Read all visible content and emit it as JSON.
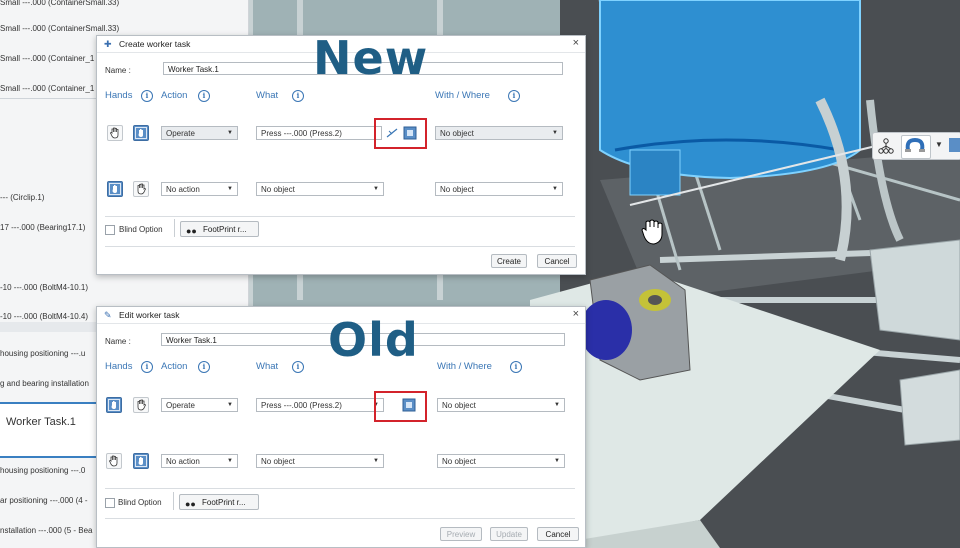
{
  "tree": {
    "items": [
      "Small ---.000 (ContainerSmall.33)",
      "Small ---.000 (Container_1",
      "Small ---.000 (Container_1",
      "--- (Circlip.1)",
      "17 ---.000 (Bearing17.1)",
      "-10 ---.000 (BoltM4-10.1)",
      "-10 ---.000 (BoltM4-10.4)",
      "housing positioning ---.u",
      "g and bearing installation",
      "housing positioning ---.0",
      "ar positioning ---.000 (4 -",
      "nstallation ---.000 (5 - Bea"
    ],
    "selected": "Worker Task.1"
  },
  "new_dialog": {
    "title": "Create worker task",
    "name_label": "Name :",
    "name_value": "Worker Task.1",
    "headers": {
      "hands": "Hands",
      "action": "Action",
      "what": "What",
      "with": "With / Where"
    },
    "row1": {
      "action": "Operate",
      "what": "Press ---.000 (Press.2)",
      "with": "No object"
    },
    "row2": {
      "action": "No action",
      "what": "No object",
      "with": "No object"
    },
    "blind_option": "Blind Option",
    "footprint": "FootPrint r...",
    "buttons": {
      "create": "Create",
      "cancel": "Cancel"
    }
  },
  "old_dialog": {
    "title": "Edit worker task",
    "name_label": "Name :",
    "name_value": "Worker Task.1",
    "headers": {
      "hands": "Hands",
      "action": "Action",
      "what": "What",
      "with": "With / Where"
    },
    "row1": {
      "action": "Operate",
      "what": "Press ---.000 (Press.2)",
      "with": "No object"
    },
    "row2": {
      "action": "No action",
      "what": "No object",
      "with": "No object"
    },
    "blind_option": "Blind Option",
    "footprint": "FootPrint r...",
    "buttons": {
      "preview": "Preview",
      "update": "Update",
      "cancel": "Cancel"
    }
  },
  "overlay": {
    "new": "New",
    "old": "Old"
  },
  "icons": [
    "hand-icon",
    "info-icon",
    "link-icon",
    "select-object-icon",
    "footprint-icon",
    "close-icon",
    "tree-icon",
    "magnet-icon"
  ],
  "colors": {
    "accent": "#3a76b5",
    "highlight": "#d3232b",
    "overlay_text": "#1f5e85"
  }
}
